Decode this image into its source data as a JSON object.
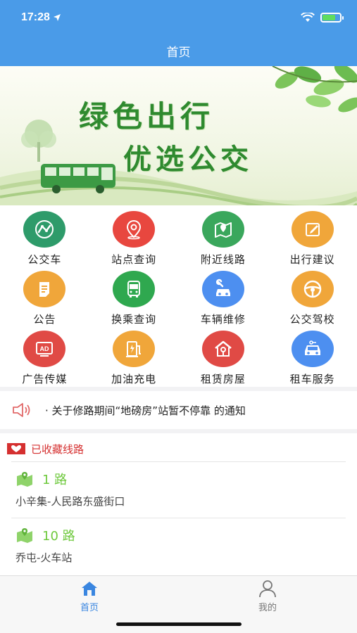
{
  "status": {
    "time": "17:28"
  },
  "nav": {
    "title": "首页"
  },
  "banner": {
    "line1": "绿色出行",
    "line2": "优选公交"
  },
  "grid": [
    {
      "label": "公交车",
      "icon": "route-icon",
      "color": "#2e9b6a"
    },
    {
      "label": "站点查询",
      "icon": "location-pin-icon",
      "color": "#e8473f"
    },
    {
      "label": "附近线路",
      "icon": "map-icon",
      "color": "#3aa75c"
    },
    {
      "label": "出行建议",
      "icon": "edit-icon",
      "color": "#f0a63a"
    },
    {
      "label": "公告",
      "icon": "document-icon",
      "color": "#f0a63a"
    },
    {
      "label": "换乘查询",
      "icon": "bus-icon",
      "color": "#2fa84f"
    },
    {
      "label": "车辆维修",
      "icon": "car-repair-icon",
      "color": "#4d8ff0"
    },
    {
      "label": "公交驾校",
      "icon": "steering-wheel-icon",
      "color": "#f0a63a"
    },
    {
      "label": "广告传媒",
      "icon": "ad-icon",
      "color": "#e04a45"
    },
    {
      "label": "加油充电",
      "icon": "fuel-charge-icon",
      "color": "#f0a63a"
    },
    {
      "label": "租赁房屋",
      "icon": "house-key-icon",
      "color": "#e04a45"
    },
    {
      "label": "租车服务",
      "icon": "car-rental-icon",
      "color": "#4d8ff0"
    }
  ],
  "notice": {
    "text": "· 关于修路期间“地磅房”站暂不停靠  的通知"
  },
  "favorites": {
    "title": "已收藏线路",
    "routes": [
      {
        "name": "1 路",
        "stops": "小辛集-人民路东盛街口"
      },
      {
        "name": "10 路",
        "stops": "乔屯-火车站"
      }
    ]
  },
  "tabbar": {
    "home": {
      "label": "首页",
      "color": "#3a86e0"
    },
    "mine": {
      "label": "我的",
      "color": "#777777"
    }
  }
}
